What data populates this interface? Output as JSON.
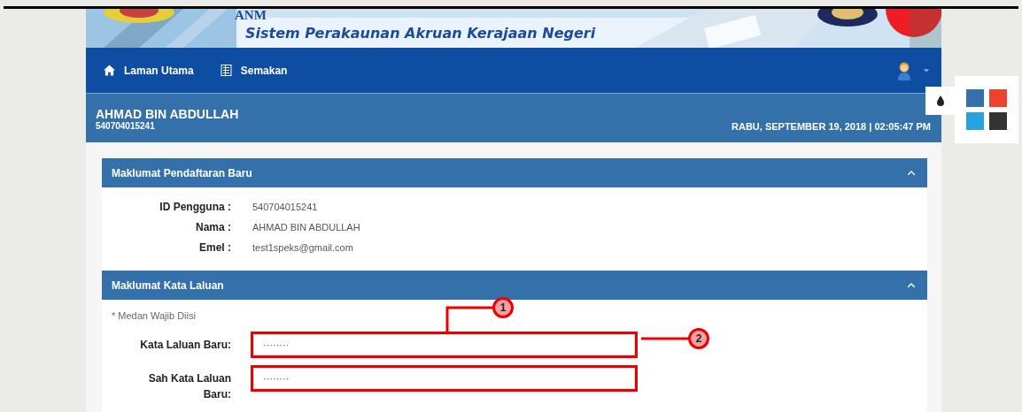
{
  "banner": {
    "acronym": "ANM",
    "system_name": "Sistem Perakaunan Akruan Kerajaan Negeri"
  },
  "nav": {
    "items": [
      {
        "label": "Laman Utama",
        "kind": "home"
      },
      {
        "label": "Semakan",
        "kind": "list"
      }
    ]
  },
  "header": {
    "name": "AHMAD BIN ABDULLAH",
    "id": "540704015241",
    "datetime": "RABU, SEPTEMBER 19, 2018 | 02:05:47 PM"
  },
  "panels": [
    {
      "title": "Maklumat Pendaftaran Baru",
      "expanded": true,
      "kind": "info",
      "rows": [
        {
          "label": "ID Pengguna :",
          "value": "540704015241"
        },
        {
          "label": "Nama :",
          "value": "AHMAD BIN ABDULLAH"
        },
        {
          "label": "Emel :",
          "value": "test1speks@gmail.com"
        }
      ]
    },
    {
      "title": "Maklumat Kata Laluan",
      "expanded": true,
      "kind": "form",
      "note": "* Medan Wajib Diisi",
      "fields": [
        {
          "label": "Kata Laluan Baru:",
          "value": "········"
        },
        {
          "label": "Sah Kata Laluan Baru:",
          "value": "········"
        }
      ]
    }
  ],
  "theme_swatches": [
    {
      "color": "#3470aa"
    },
    {
      "color": "#f0412f"
    },
    {
      "color": "#29a3e0"
    },
    {
      "color": "#333333"
    }
  ],
  "callouts": [
    {
      "label": "1"
    },
    {
      "label": "2"
    }
  ]
}
